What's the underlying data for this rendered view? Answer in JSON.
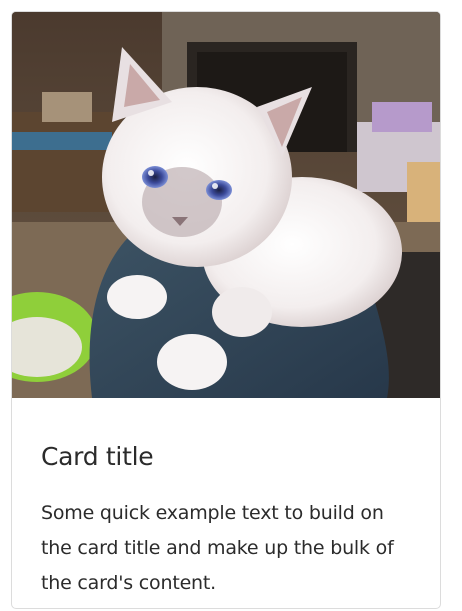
{
  "card": {
    "image_alt": "White fluffy kitten with blue eyes",
    "title": "Card title",
    "text": "Some quick example text to build on the card title and make up the bulk of the card's content."
  }
}
